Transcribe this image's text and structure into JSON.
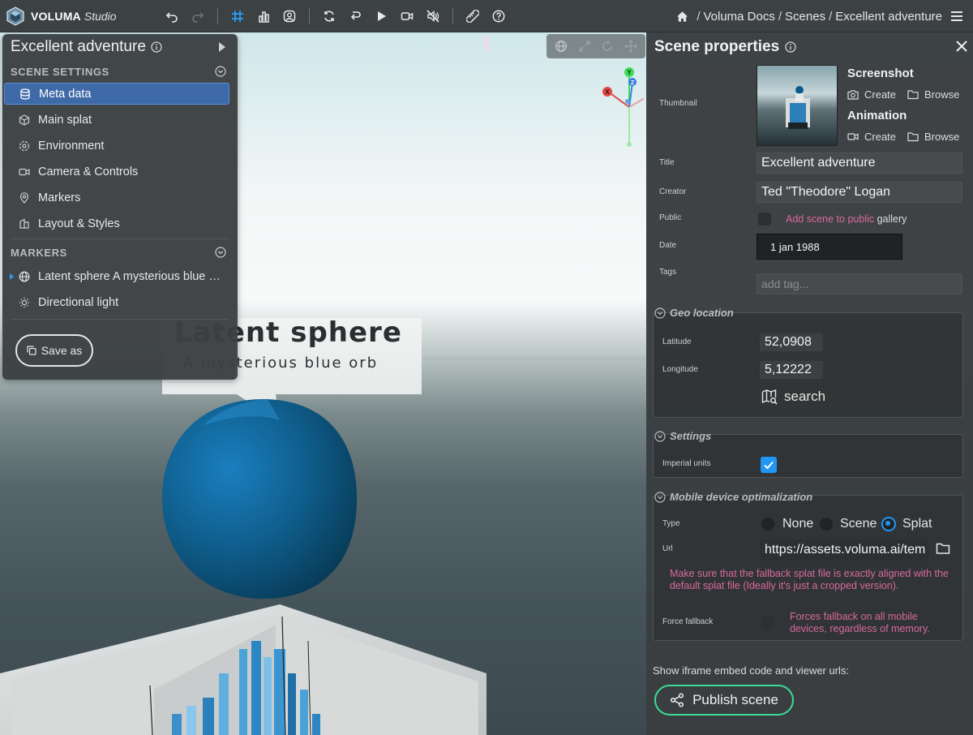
{
  "app": {
    "brand_name": "VOLUMA",
    "brand_sub": "Studio"
  },
  "toolbar": {
    "icons": [
      "undo-icon",
      "redo-icon",
      "grid-icon",
      "chart-icon",
      "user-circle-icon",
      "refresh-icon",
      "rotate-icon",
      "play-icon",
      "video-icon",
      "mute-icon",
      "ruler-icon",
      "help-icon"
    ]
  },
  "breadcrumb": {
    "home_icon": "home-icon",
    "items": [
      "Voluma Docs",
      "Scenes",
      "Excellent adventure"
    ]
  },
  "left_panel": {
    "title": "Excellent adventure",
    "scene_settings_header": "SCENE SETTINGS",
    "items": [
      "Meta data",
      "Main splat",
      "Environment",
      "Camera & Controls",
      "Markers",
      "Layout & Styles"
    ],
    "markers_header": "MARKERS",
    "markers": [
      "Latent sphere A mysterious blue orb",
      "Directional light"
    ],
    "save_as": "Save as"
  },
  "viewport": {
    "label_title": "Latent sphere",
    "label_subtitle": "A mysterious blue orb",
    "gizmo_axes": [
      "Y",
      "Z",
      "X"
    ]
  },
  "right_panel": {
    "title": "Scene properties",
    "thumbnail_label": "Thumbnail",
    "screenshot_title": "Screenshot",
    "animation_title": "Animation",
    "create_label": "Create",
    "browse_label": "Browse",
    "title_label": "Title",
    "title_value": "Excellent adventure",
    "creator_label": "Creator",
    "creator_value": "Ted \"Theodore\" Logan",
    "public_label": "Public",
    "public_text_pink": "Add scene to public",
    "public_text_plain": " gallery",
    "date_label": "Date",
    "date_value": "1 jan 1988",
    "tags_label": "Tags",
    "tags_placeholder": "add tag...",
    "geo_title": "Geo location",
    "latitude_label": "Latitude",
    "latitude_value": "52,0908",
    "longitude_label": "Longitude",
    "longitude_value": "5,12222",
    "search_label": "search",
    "settings_title": "Settings",
    "imperial_label": "Imperial units",
    "imperial_checked": true,
    "mobile_title": "Mobile device optimalization",
    "type_label": "Type",
    "type_options": [
      "None",
      "Scene",
      "Splat"
    ],
    "type_selected": "Splat",
    "url_label": "Url",
    "url_value": "https://assets.voluma.ai/tem",
    "url_warning": "Make sure that the fallback splat file is exactly aligned with the default splat file (Ideally it's just a cropped version).",
    "force_label": "Force fallback",
    "force_text": "Forces fallback on all mobile devices, regardless of memory.",
    "embed_text": "Show iframe embed code and viewer urls:",
    "publish_label": "Publish scene"
  },
  "colors": {
    "accent": "#2196f3",
    "publish_border": "#3ddc97",
    "pink": "#d96a9a",
    "active_item": "#3f6aa8"
  }
}
